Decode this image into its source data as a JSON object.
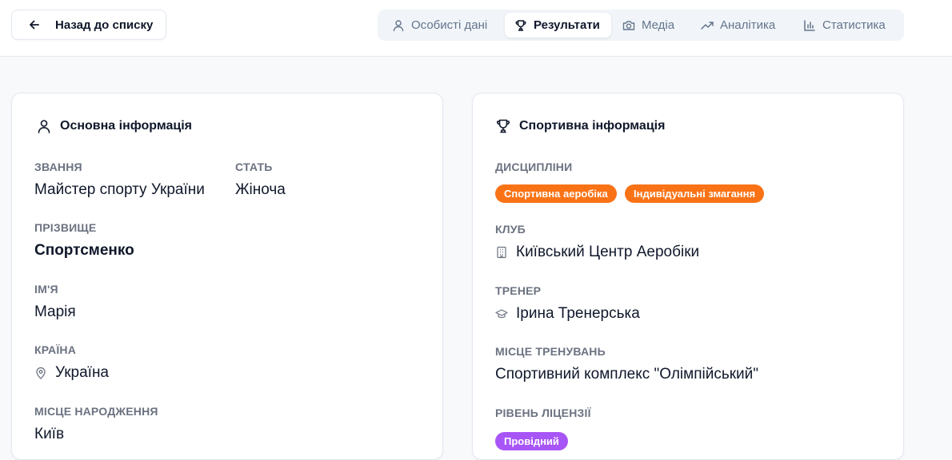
{
  "header": {
    "back_label": "Назад до списку",
    "tabs": [
      {
        "label": "Особисті дані",
        "icon": "user-icon",
        "active": false
      },
      {
        "label": "Результати",
        "icon": "trophy-icon",
        "active": true
      },
      {
        "label": "Медіа",
        "icon": "camera-icon",
        "active": false
      },
      {
        "label": "Аналітика",
        "icon": "trending-up-icon",
        "active": false
      },
      {
        "label": "Статистика",
        "icon": "bar-chart-icon",
        "active": false
      }
    ]
  },
  "basic": {
    "title": "Основна інформація",
    "rank_label": "ЗВАННЯ",
    "rank_value": "Майстер спорту України",
    "gender_label": "СТАТЬ",
    "gender_value": "Жіноча",
    "surname_label": "ПРІЗВИЩЕ",
    "surname_value": "Спортсменко",
    "name_label": "ІМ'Я",
    "name_value": "Марія",
    "country_label": "КРАЇНА",
    "country_value": "Україна",
    "birthplace_label": "МІСЦЕ НАРОДЖЕННЯ",
    "birthplace_value": "Київ"
  },
  "sport": {
    "title": "Спортивна інформація",
    "disciplines_label": "ДИСЦИПЛІНИ",
    "disciplines": [
      "Спортивна аеробіка",
      "Індивідуальні змагання"
    ],
    "club_label": "КЛУБ",
    "club_value": "Київський Центр Аеробіки",
    "coach_label": "ТРЕНЕР",
    "coach_value": "Ірина Тренерська",
    "training_place_label": "МІСЦЕ ТРЕНУВАНЬ",
    "training_place_value": "Спортивний комплекс \"Олімпійський\"",
    "license_label": "РІВЕНЬ ЛІЦЕНЗІЇ",
    "license_value": "Провідний"
  },
  "colors": {
    "accent_orange": "#f97316",
    "license_purple": "#a855f7",
    "label_gray": "#6b7280"
  }
}
